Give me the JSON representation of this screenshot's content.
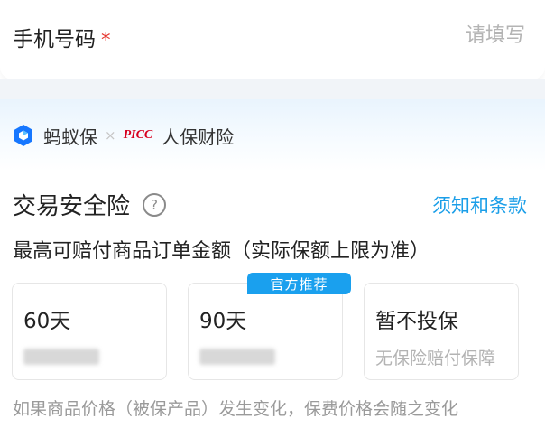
{
  "phone": {
    "label": "手机号码",
    "required_mark": "*",
    "placeholder": "请填写",
    "value": ""
  },
  "brands": {
    "primary_name": "蚂蚁保",
    "separator": "×",
    "partner_logo_text": "PICC",
    "partner_name": "人保财险"
  },
  "insurance": {
    "title": "交易安全险",
    "help_icon": "question-circle-icon",
    "terms_link": "须知和条款",
    "subtitle": "最高可赔付商品订单金额（实际保额上限为准）",
    "options": [
      {
        "title": "60天",
        "price_hidden": true
      },
      {
        "title": "90天",
        "price_hidden": true,
        "badge": "官方推荐"
      },
      {
        "title": "暂不投保",
        "description": "无保险赔付保障"
      }
    ],
    "footer_note": "如果商品价格（被保产品）发生变化，保费价格会随之变化"
  },
  "colors": {
    "accent": "#1aa0ee",
    "required": "#e5332b",
    "picc_red": "#d7001f",
    "ant_blue": "#1677ff"
  }
}
